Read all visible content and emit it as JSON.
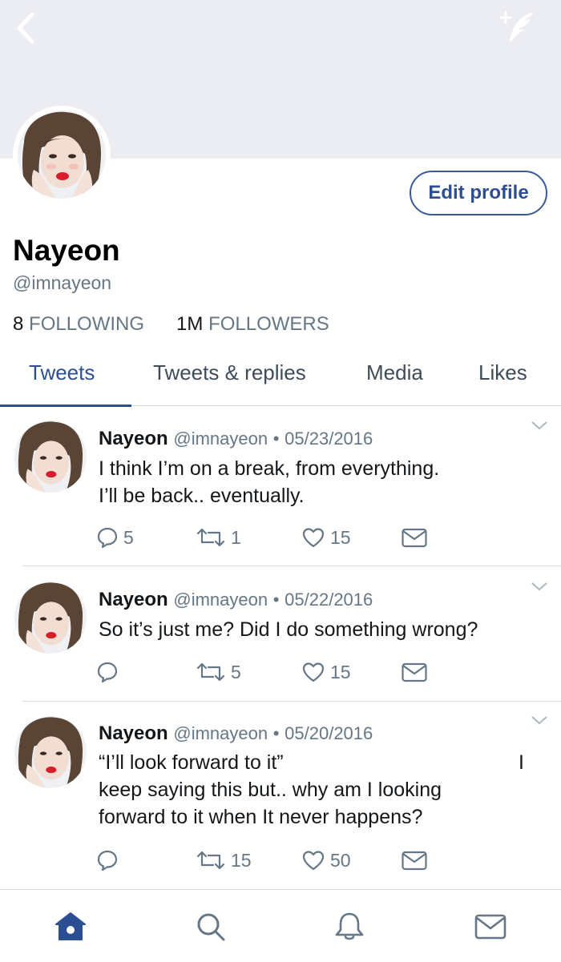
{
  "colors": {
    "accent": "#2c4f93",
    "secondary_text": "#657786",
    "header_bg": "#ececf3"
  },
  "profile": {
    "name": "Nayeon",
    "handle": "@imnayeon",
    "following_count": "8",
    "following_label": "FOLLOWING",
    "followers_count": "1M",
    "followers_label": "FOLLOWERS",
    "edit_label": "Edit profile"
  },
  "tabs": [
    {
      "label": "Tweets",
      "active": true
    },
    {
      "label": "Tweets & replies"
    },
    {
      "label": "Media"
    },
    {
      "label": "Likes"
    }
  ],
  "tweets": [
    {
      "name": "Nayeon",
      "handle": "@imnayeon",
      "sep": "•",
      "date": "05/23/2016",
      "lines": [
        "I think I’m on a break, from everything.",
        "I’ll be back.. eventually."
      ],
      "replies": "5",
      "retweets": "1",
      "likes": "15"
    },
    {
      "name": "Nayeon",
      "handle": "@imnayeon",
      "sep": "•",
      "date": "05/22/2016",
      "lines": [
        "So it’s just me? Did I do something wrong?"
      ],
      "replies": "",
      "retweets": "5",
      "likes": "15"
    },
    {
      "name": "Nayeon",
      "handle": "@imnayeon",
      "sep": "•",
      "date": "05/20/2016",
      "lines": [
        "“I’ll look forward to it”",
        "keep saying this but.. why am I looking",
        "forward to it when It never happens?"
      ],
      "stray": "I",
      "replies": "",
      "retweets": "15",
      "likes": "50"
    }
  ],
  "icons": {
    "back": "back-chevron-icon",
    "compose": "compose-feather-icon",
    "reply": "reply-bubble-icon",
    "retweet": "retweet-icon",
    "like": "heart-icon",
    "dm": "envelope-icon",
    "more": "chevron-down-icon",
    "nav": [
      "home-icon",
      "search-icon",
      "notifications-bell-icon",
      "messages-envelope-icon"
    ]
  }
}
